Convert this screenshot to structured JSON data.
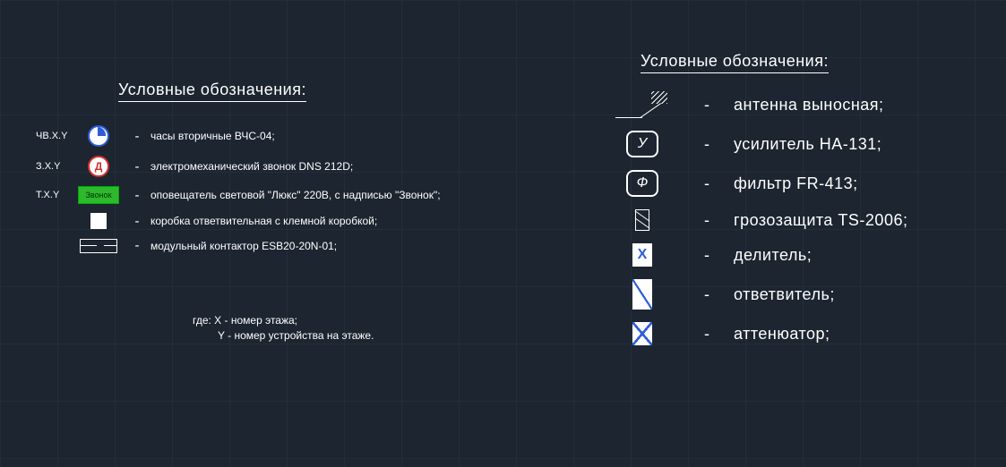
{
  "left": {
    "header": "Условные обозначения:",
    "items": [
      {
        "tag": "ЧВ.X.Y",
        "desc": "часы вторичные ВЧС-04;"
      },
      {
        "tag": "З.X.Y",
        "desc": "электромеханический звонок DNS 212D;"
      },
      {
        "tag": "Т.X.Y",
        "desc": "оповещатель световой \"Люкс\" 220В, с надписью \"Звонок\";",
        "badge": "Звонок"
      },
      {
        "tag": "",
        "desc": "коробка ответвительная с клемной коробкой;"
      },
      {
        "tag": "",
        "desc": "модульный контактор ESB20-20N-01;"
      }
    ],
    "note": {
      "line1": "где: X - номер этажа;",
      "line2": "Y - номер устройства на этаже."
    }
  },
  "right": {
    "header": "Условные обозначения:",
    "items": [
      {
        "letter": "",
        "desc": "антенна выносная;"
      },
      {
        "letter": "У",
        "desc": "усилитель HA-131;"
      },
      {
        "letter": "Ф",
        "desc": "фильтр FR-413;"
      },
      {
        "letter": "",
        "desc": "грозозащита TS-2006;"
      },
      {
        "letter": "X",
        "desc": "делитель;"
      },
      {
        "letter": "",
        "desc": "ответвитель;"
      },
      {
        "letter": "",
        "desc": "аттенюатор;"
      }
    ]
  },
  "dash": "-"
}
